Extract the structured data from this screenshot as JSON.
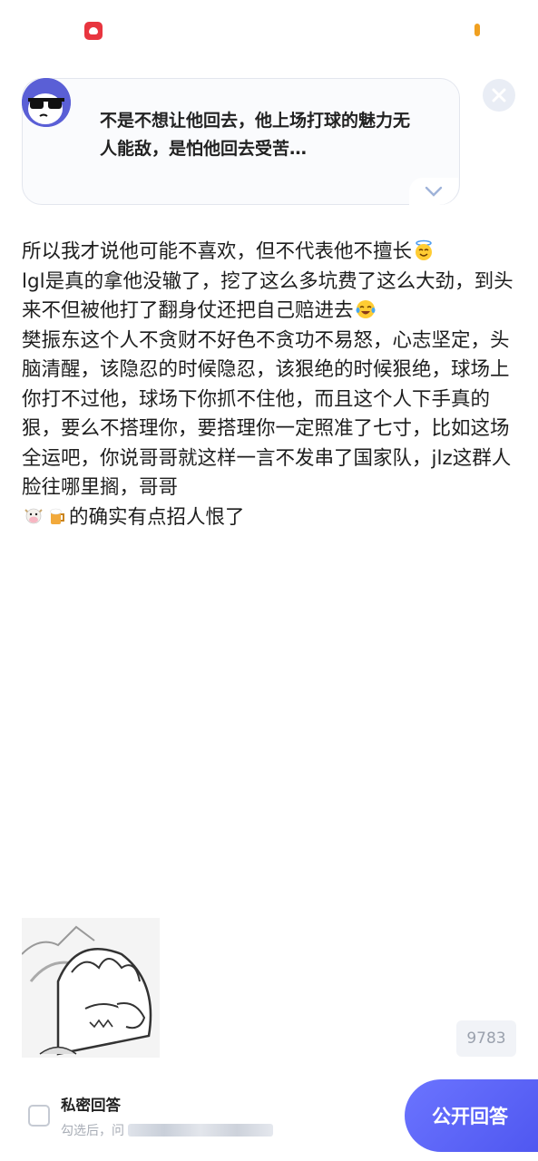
{
  "status_bar": {
    "app_icon": "heart-app-icon",
    "indicator_color": "#f0a020"
  },
  "question": {
    "text": "不是不想让他回去，他上场打球的魅力无人能敌，是怕他回去受苦…",
    "avatar_icon": "sunglasses-avatar-icon",
    "expand_icon": "chevron-down-icon",
    "close_icon": "close-icon"
  },
  "answer": {
    "p1_a": "所以我才说他可能不喜欢，但不代表他不擅长",
    "p1_emoji": "halo-smile-emoji",
    "p2_a": "lgl是真的拿他没辙了，挖了这么多坑费了这么大劲，到头来不但被他打了翻身仗还把自己赔进去",
    "p2_emoji": "tears-of-joy-emoji",
    "p3_a": "樊振东这个人不贪财不好色不贪功不易怒，心志坚定，头脑清醒，该隐忍的时候隐忍，该狠绝的时候狠绝，球场上你打不过他，球场下你抓不住他，而且这个人下手真的狠，要么不搭理你，要搭理你一定照准了七寸，比如这场全运吧，你说哥哥就这样一言不发串了国家队，jlz这群人脸往哪里搁，哥哥",
    "p3_emoji_1": "cow-face-emoji",
    "p3_emoji_2": "beer-mug-emoji",
    "p3_b": "的确实有点招人恨了"
  },
  "sticker": {
    "icon": "cartoon-sticker-image"
  },
  "editor": {
    "word_count": "9783",
    "private_label": "私密回答",
    "private_hint": "勾选后，问",
    "publish_label": "公开回答"
  },
  "colors": {
    "accent": "#5a62f5",
    "avatar_bg": "#5a5fd6"
  }
}
